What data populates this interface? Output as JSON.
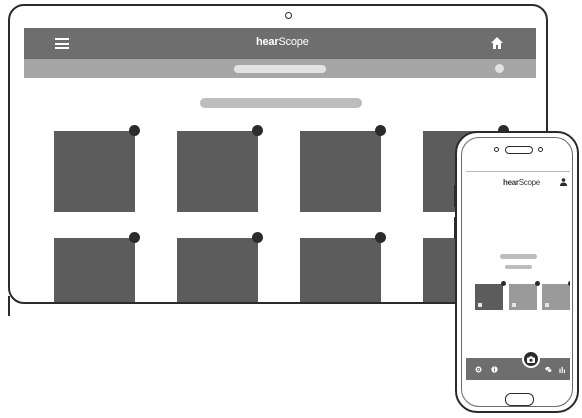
{
  "laptop": {
    "brand_prefix": "hear",
    "brand_suffix": "Scope",
    "tiles_per_row": 4,
    "tile_rows": 2
  },
  "phone": {
    "brand_prefix": "hear",
    "brand_suffix": "Scope",
    "tiles": 3
  },
  "colors": {
    "topbar": "#6e6e6e",
    "subbar": "#a6a6a6",
    "tile": "#5c5c5c",
    "phone_tile_active": "#5c5c5c",
    "phone_tile": "#9a9a9a",
    "outline": "#2b2b2b"
  },
  "icons": {
    "menu": "menu-icon",
    "home": "home-icon",
    "user": "user-icon",
    "camera": "camera-icon",
    "settings": "gear-icon",
    "info": "info-icon",
    "chat": "chat-icon",
    "stats": "stats-icon"
  }
}
